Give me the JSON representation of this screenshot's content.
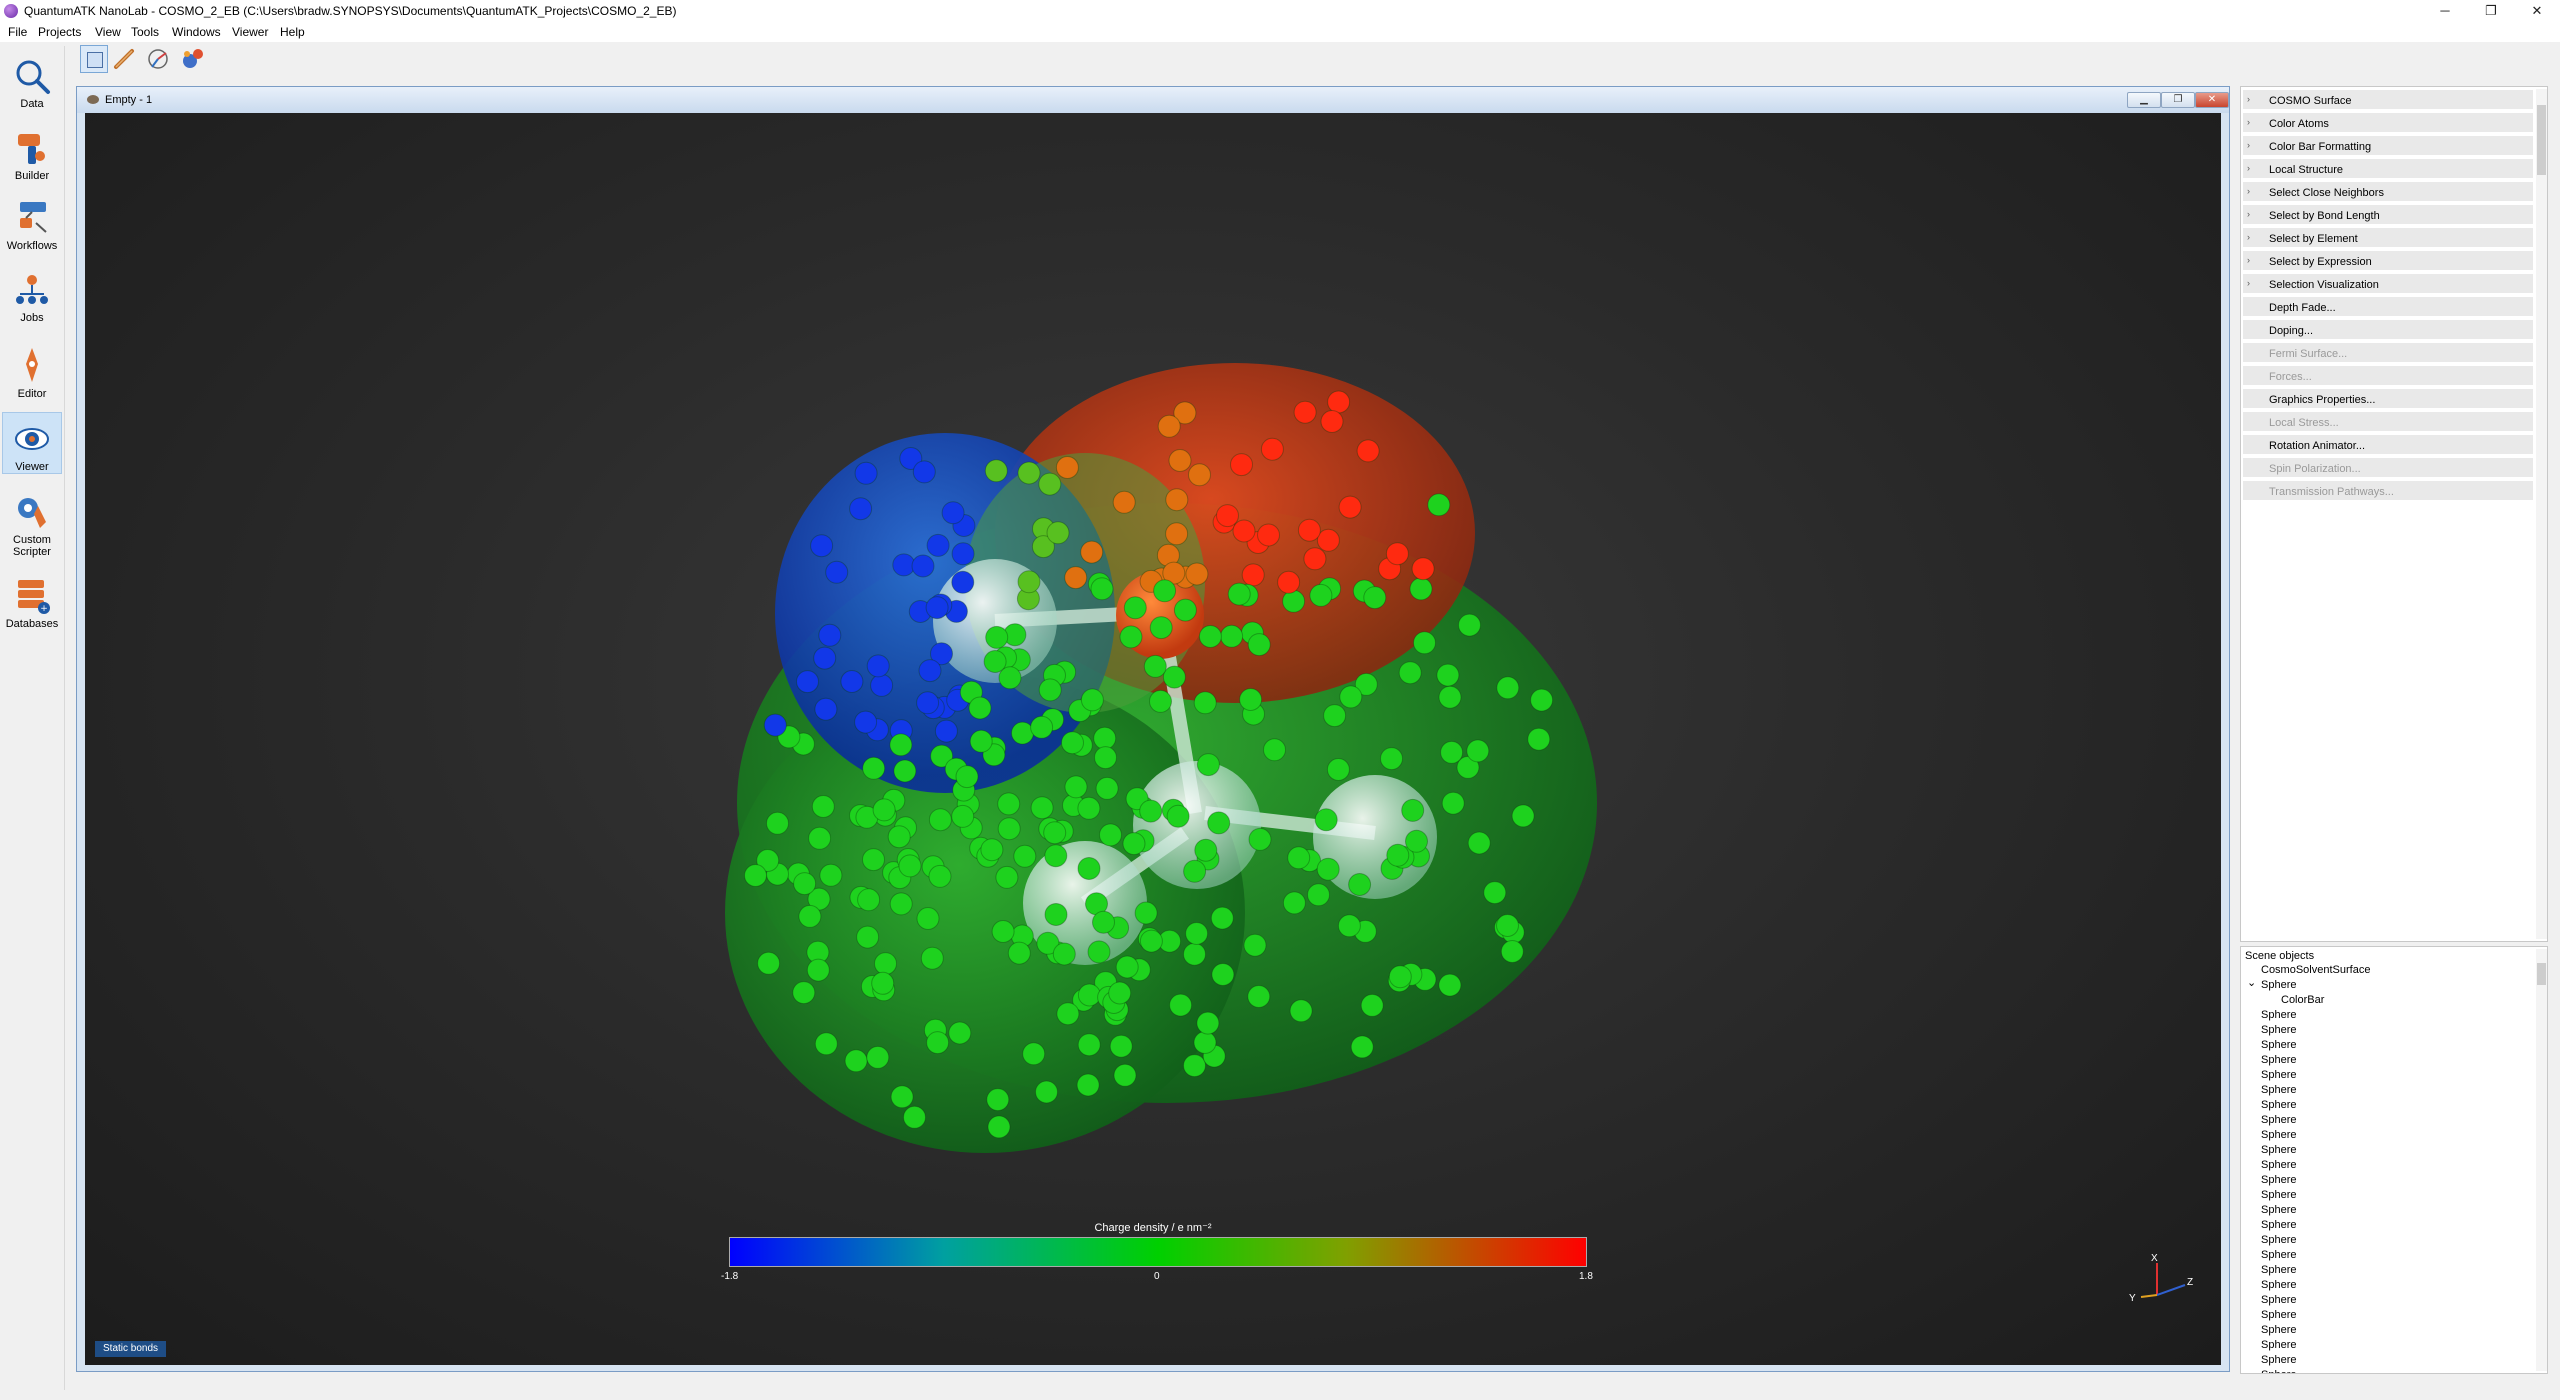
{
  "window": {
    "title": "QuantumATK NanoLab - COSMO_2_EB (C:\\Users\\bradw.SYNOPSYS\\Documents\\QuantumATK_Projects\\COSMO_2_EB)",
    "minimize": "─",
    "restore": "❐",
    "close": "✕"
  },
  "menu": [
    "File",
    "Projects",
    "View",
    "Tools",
    "Windows",
    "Viewer",
    "Help"
  ],
  "sidebar": {
    "items": [
      {
        "label": "Data",
        "icon": "magnifier-icon"
      },
      {
        "label": "Builder",
        "icon": "builder-icon"
      },
      {
        "label": "Workflows",
        "icon": "workflows-icon"
      },
      {
        "label": "Jobs",
        "icon": "jobs-icon"
      },
      {
        "label": "Editor",
        "icon": "pen-icon"
      },
      {
        "label": "Viewer",
        "icon": "eye-icon"
      },
      {
        "label": "Custom\nScripter",
        "icon": "scripter-icon"
      },
      {
        "label": "Databases",
        "icon": "database-icon"
      }
    ]
  },
  "viewer": {
    "title": "Empty - 1",
    "static_bonds": "Static bonds",
    "colorbar": {
      "label": "Charge density / e nm⁻²",
      "min_label": "-1.8",
      "mid_label": "0",
      "max_label": "1.8",
      "colors": [
        "#0000ff",
        "#00d000",
        "#ff0000"
      ]
    },
    "axes": {
      "x": "X",
      "y": "Y",
      "z": "Z"
    }
  },
  "plugins": [
    {
      "label": "COSMO Surface",
      "expandable": true,
      "enabled": true
    },
    {
      "label": "Color Atoms",
      "expandable": true,
      "enabled": true
    },
    {
      "label": "Color Bar Formatting",
      "expandable": true,
      "enabled": true
    },
    {
      "label": "Local Structure",
      "expandable": true,
      "enabled": true
    },
    {
      "label": "Select Close Neighbors",
      "expandable": true,
      "enabled": true
    },
    {
      "label": "Select by Bond Length",
      "expandable": true,
      "enabled": true
    },
    {
      "label": "Select by Element",
      "expandable": true,
      "enabled": true
    },
    {
      "label": "Select by Expression",
      "expandable": true,
      "enabled": true
    },
    {
      "label": "Selection Visualization",
      "expandable": true,
      "enabled": true
    },
    {
      "label": "Depth Fade...",
      "expandable": false,
      "enabled": true
    },
    {
      "label": "Doping...",
      "expandable": false,
      "enabled": true
    },
    {
      "label": "Fermi Surface...",
      "expandable": false,
      "enabled": false
    },
    {
      "label": "Forces...",
      "expandable": false,
      "enabled": false
    },
    {
      "label": "Graphics Properties...",
      "expandable": false,
      "enabled": true
    },
    {
      "label": "Local Stress...",
      "expandable": false,
      "enabled": false
    },
    {
      "label": "Rotation Animator...",
      "expandable": false,
      "enabled": true
    },
    {
      "label": "Spin Polarization...",
      "expandable": false,
      "enabled": false
    },
    {
      "label": "Transmission Pathways...",
      "expandable": false,
      "enabled": false
    }
  ],
  "scene_objects": {
    "header": "Scene objects",
    "items": [
      {
        "label": "CosmoSolventSurface",
        "indent": 1
      },
      {
        "label": "Sphere",
        "indent": 1,
        "expanded": true
      },
      {
        "label": "ColorBar",
        "indent": 2
      },
      {
        "label": "Sphere",
        "indent": 1
      },
      {
        "label": "Sphere",
        "indent": 1
      },
      {
        "label": "Sphere",
        "indent": 1
      },
      {
        "label": "Sphere",
        "indent": 1
      },
      {
        "label": "Sphere",
        "indent": 1
      },
      {
        "label": "Sphere",
        "indent": 1
      },
      {
        "label": "Sphere",
        "indent": 1
      },
      {
        "label": "Sphere",
        "indent": 1
      },
      {
        "label": "Sphere",
        "indent": 1
      },
      {
        "label": "Sphere",
        "indent": 1
      },
      {
        "label": "Sphere",
        "indent": 1
      },
      {
        "label": "Sphere",
        "indent": 1
      },
      {
        "label": "Sphere",
        "indent": 1
      },
      {
        "label": "Sphere",
        "indent": 1
      },
      {
        "label": "Sphere",
        "indent": 1
      },
      {
        "label": "Sphere",
        "indent": 1
      },
      {
        "label": "Sphere",
        "indent": 1
      },
      {
        "label": "Sphere",
        "indent": 1
      },
      {
        "label": "Sphere",
        "indent": 1
      },
      {
        "label": "Sphere",
        "indent": 1
      },
      {
        "label": "Sphere",
        "indent": 1
      },
      {
        "label": "Sphere",
        "indent": 1
      },
      {
        "label": "Sphere",
        "indent": 1
      },
      {
        "label": "Sphere",
        "indent": 1
      },
      {
        "label": "Sphere",
        "indent": 1
      }
    ]
  }
}
